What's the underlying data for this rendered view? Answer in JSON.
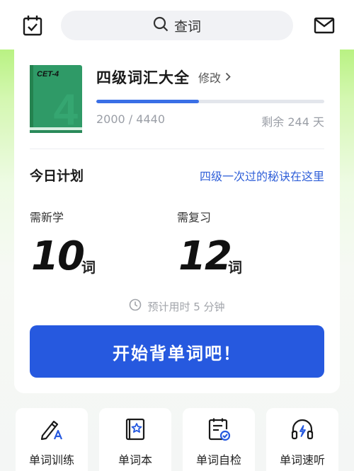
{
  "header": {
    "search_label": "查词",
    "icons": [
      "calendar-check-icon",
      "search-icon",
      "mail-icon"
    ]
  },
  "book": {
    "cover_label": "CET-4",
    "cover_number": "4",
    "cover_color": "#2f9a67",
    "title": "四级词汇大全",
    "edit_label": "修改",
    "progress_text": "2000 / 4440",
    "progress_fraction": 0.45,
    "remaining_text": "剩余 244 天"
  },
  "plan": {
    "title": "今日计划",
    "tip_link": "四级一次过的秘诀在这里",
    "new": {
      "label": "需新学",
      "count": "10",
      "unit": "词"
    },
    "review": {
      "label": "需复习",
      "count": "12",
      "unit": "词"
    },
    "estimate": "预计用时 5 分钟",
    "start_button": "开始背单词吧！"
  },
  "bottom_nav": [
    {
      "label": "单词训练",
      "icon": "pencil-a-icon"
    },
    {
      "label": "单词本",
      "icon": "star-book-icon"
    },
    {
      "label": "单词自检",
      "icon": "clipboard-check-icon"
    },
    {
      "label": "单词速听",
      "icon": "headphones-bolt-icon"
    }
  ],
  "colors": {
    "accent": "#2659df",
    "link": "#2f5fd8",
    "background_green": "#b9f283"
  }
}
